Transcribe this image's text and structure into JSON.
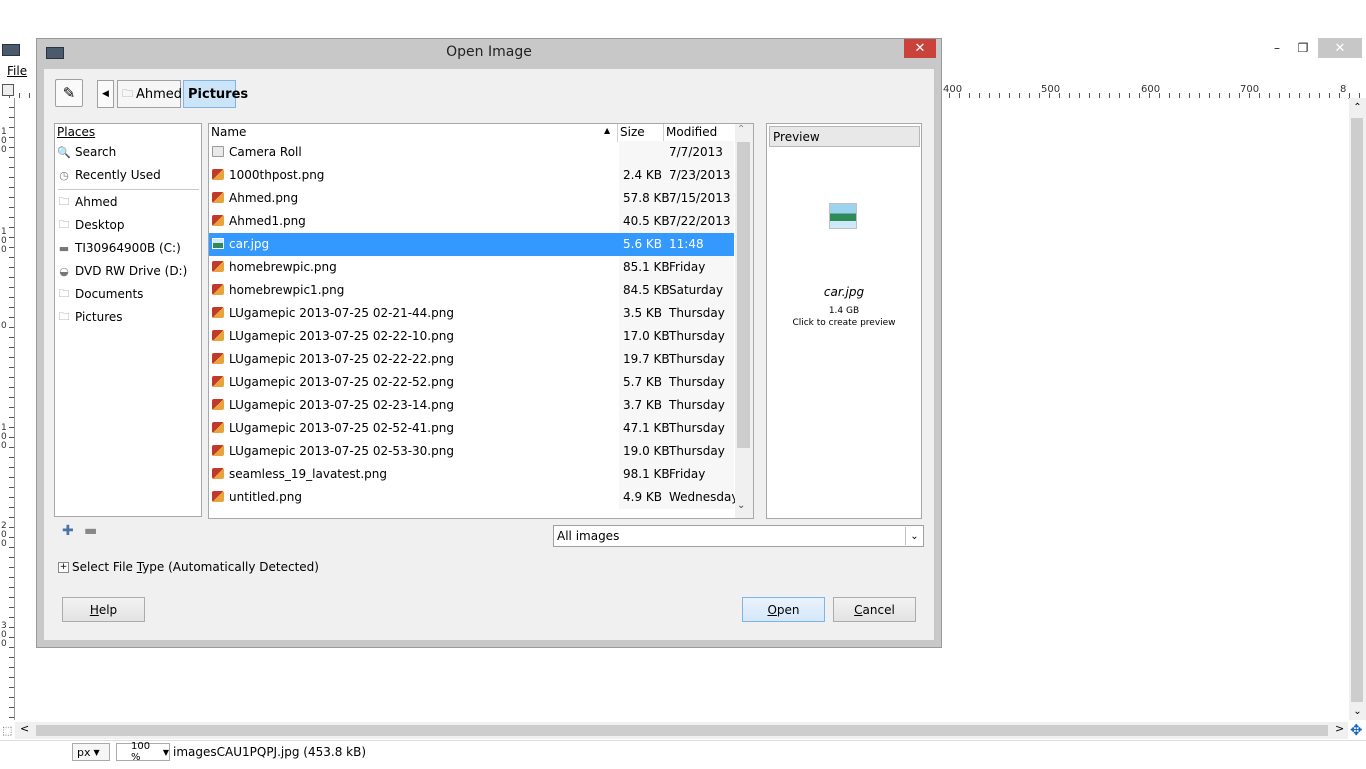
{
  "gimp": {
    "menu_file": "File",
    "ruler_top_labels": [
      "400",
      "500",
      "600",
      "700",
      "8"
    ],
    "ruler_left_labels": [
      "1\n0\n0",
      "1\n0\n0",
      "0",
      "1\n0\n0",
      "2\n0\n0",
      "3\n0\n0"
    ],
    "status": {
      "unit": "px",
      "zoom": "100 %",
      "filename": "imagesCAU1PQPJ.jpg (453.8 kB)"
    }
  },
  "dialog": {
    "title": "Open Image",
    "path": [
      "Ahmed",
      "Pictures"
    ],
    "places": {
      "header": "Places",
      "items": [
        {
          "label": "Search",
          "icon": "search-icon"
        },
        {
          "label": "Recently Used",
          "icon": "recent-icon"
        },
        {
          "label": "Ahmed",
          "icon": "folder-icon"
        },
        {
          "label": "Desktop",
          "icon": "folder-icon"
        },
        {
          "label": "TI30964900B (C:)",
          "icon": "drive-icon"
        },
        {
          "label": "DVD RW Drive (D:)",
          "icon": "dvd-icon"
        },
        {
          "label": "Documents",
          "icon": "folder-icon"
        },
        {
          "label": "Pictures",
          "icon": "folder-icon"
        }
      ]
    },
    "columns": {
      "name": "Name",
      "size": "Size",
      "modified": "Modified"
    },
    "files": [
      {
        "name": "Camera Roll",
        "size": "",
        "modified": "7/7/2013",
        "type": "folder"
      },
      {
        "name": "1000thpost.png",
        "size": "2.4 KB",
        "modified": "7/23/2013",
        "type": "png"
      },
      {
        "name": "Ahmed.png",
        "size": "57.8 KB",
        "modified": "7/15/2013",
        "type": "png"
      },
      {
        "name": "Ahmed1.png",
        "size": "40.5 KB",
        "modified": "7/22/2013",
        "type": "png"
      },
      {
        "name": "car.jpg",
        "size": "5.6 KB",
        "modified": "11:48",
        "type": "jpg",
        "selected": true
      },
      {
        "name": "homebrewpic.png",
        "size": "85.1 KB",
        "modified": "Friday",
        "type": "png"
      },
      {
        "name": "homebrewpic1.png",
        "size": "84.5 KB",
        "modified": "Saturday",
        "type": "png"
      },
      {
        "name": "LUgamepic 2013-07-25 02-21-44.png",
        "size": "3.5 KB",
        "modified": "Thursday",
        "type": "png"
      },
      {
        "name": "LUgamepic 2013-07-25 02-22-10.png",
        "size": "17.0 KB",
        "modified": "Thursday",
        "type": "png"
      },
      {
        "name": "LUgamepic 2013-07-25 02-22-22.png",
        "size": "19.7 KB",
        "modified": "Thursday",
        "type": "png"
      },
      {
        "name": "LUgamepic 2013-07-25 02-22-52.png",
        "size": "5.7 KB",
        "modified": "Thursday",
        "type": "png"
      },
      {
        "name": "LUgamepic 2013-07-25 02-23-14.png",
        "size": "3.7 KB",
        "modified": "Thursday",
        "type": "png"
      },
      {
        "name": "LUgamepic 2013-07-25 02-52-41.png",
        "size": "47.1 KB",
        "modified": "Thursday",
        "type": "png"
      },
      {
        "name": "LUgamepic 2013-07-25 02-53-30.png",
        "size": "19.0 KB",
        "modified": "Thursday",
        "type": "png"
      },
      {
        "name": "seamless_19_lavatest.png",
        "size": "98.1 KB",
        "modified": "Friday",
        "type": "png"
      },
      {
        "name": "untitled.png",
        "size": "4.9 KB",
        "modified": "Wednesday",
        "type": "png"
      }
    ],
    "preview": {
      "header": "Preview",
      "filename": "car.jpg",
      "size": "1.4 GB",
      "hint": "Click to create preview"
    },
    "filter": "All images",
    "filetype_expander": {
      "pre": "Select File ",
      "mn": "T",
      "post": "ype (Automatically Detected)"
    },
    "buttons": {
      "help": {
        "mn": "H",
        "rest": "elp"
      },
      "open": {
        "mn": "O",
        "rest": "pen"
      },
      "cancel": {
        "mn": "C",
        "rest": "ancel"
      }
    }
  }
}
